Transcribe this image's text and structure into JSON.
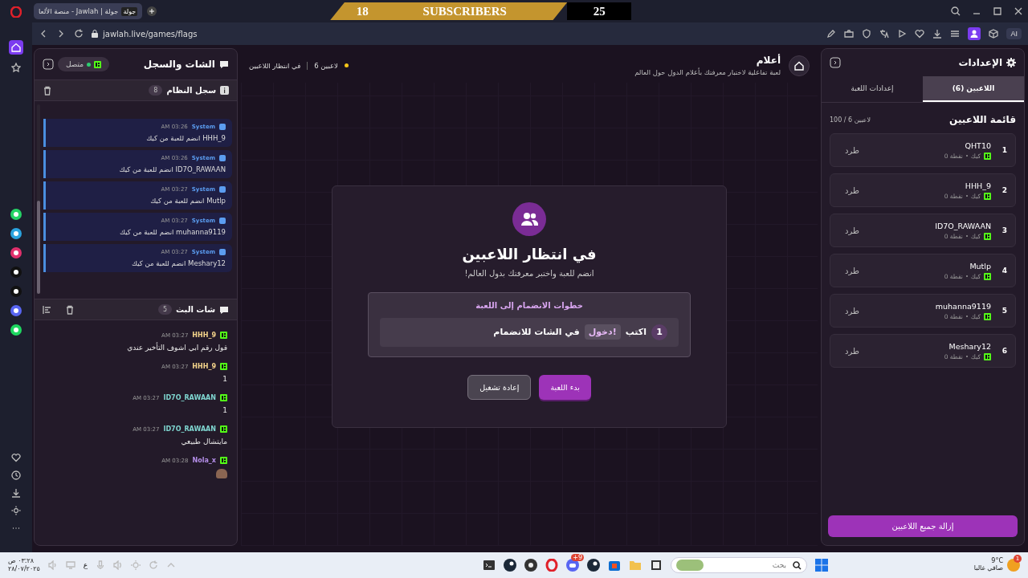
{
  "browser": {
    "tab_favicon": "جولة",
    "tab_title": "جولة | Jawlah - منصة الألعا",
    "url": "jawlah.live/games/flags",
    "ai_label": "AI"
  },
  "overlay": {
    "left_count": "18",
    "label": "SUBSCRIBERS",
    "right_count": "25"
  },
  "chat_panel": {
    "title": "الشات والسجل",
    "status": "متصل",
    "connected": true,
    "system_log": {
      "title": "سجل النظام",
      "count": "8",
      "messages": [
        {
          "sender": "System",
          "time": "03:26 AM",
          "text": "HHH_9 انضم للعبة من كيك"
        },
        {
          "sender": "System",
          "time": "03:26 AM",
          "text": "ID7O_RAWAAN انضم للعبة من كيك"
        },
        {
          "sender": "System",
          "time": "03:27 AM",
          "text": "Mutlp انضم للعبة من كيك"
        },
        {
          "sender": "System",
          "time": "03:27 AM",
          "text": "muhanna9119 انضم للعبة من كيك"
        },
        {
          "sender": "System",
          "time": "03:27 AM",
          "text": "Meshary12 انضم للعبة من كيك"
        }
      ]
    },
    "stream_chat": {
      "title": "شات البث",
      "count": "5",
      "messages": [
        {
          "user": "HHH_9",
          "color": "#f3d38a",
          "time": "03:27 AM",
          "kind": "text",
          "text": "قول رقم ابي اشوف التأخير عندي"
        },
        {
          "user": "HHH_9",
          "color": "#f3d38a",
          "time": "03:27 AM",
          "kind": "text",
          "text": "1"
        },
        {
          "user": "ID7O_RAWAAN",
          "color": "#7fd6d0",
          "time": "03:27 AM",
          "kind": "text",
          "text": "1"
        },
        {
          "user": "ID7O_RAWAAN",
          "color": "#7fd6d0",
          "time": "03:27 AM",
          "kind": "text",
          "text": "مايتشال طبيعي"
        },
        {
          "user": "Nola_x",
          "color": "#b48ee8",
          "time": "03:28 AM",
          "kind": "emote"
        }
      ]
    }
  },
  "game_header": {
    "title": "أعلام",
    "subtitle": "لعبة تفاعلية لاختبار معرفتك بأعلام الدول حول العالم",
    "players": "6 لاعبين",
    "status": "في انتظار اللاعبين"
  },
  "waiting_card": {
    "title": "في انتظار اللاعبين",
    "subtitle": "انضم للعبة واختبر معرفتك بدول العالم!",
    "steps_title": "خطوات الانضمام إلى اللعبة",
    "steps": [
      {
        "number": "1",
        "before": "اكتب",
        "keyword": "!دخول",
        "after": "في الشات للانضمام"
      }
    ],
    "buttons": [
      {
        "label": "بدء اللعبة",
        "kind": "primary"
      },
      {
        "label": "إعادة تشغيل",
        "kind": "secondary"
      }
    ]
  },
  "settings_panel": {
    "title": "الإعدادات",
    "tabs": [
      {
        "label": "اللاعبين (6)",
        "selected": true
      },
      {
        "label": "إعدادات اللعبة",
        "selected": false
      }
    ],
    "list_title": "قائمة اللاعبين",
    "capacity": "100 / 6 لاعبين",
    "players": [
      {
        "rank": "1",
        "name": "QHT10",
        "platform": "كيك",
        "points": "0 نقطة",
        "kick_label": "طرد"
      },
      {
        "rank": "2",
        "name": "HHH_9",
        "platform": "كيك",
        "points": "0 نقطة",
        "kick_label": "طرد"
      },
      {
        "rank": "3",
        "name": "ID7O_RAWAAN",
        "platform": "كيك",
        "points": "0 نقطة",
        "kick_label": "طرد"
      },
      {
        "rank": "4",
        "name": "Mutlp",
        "platform": "كيك",
        "points": "0 نقطة",
        "kick_label": "طرد"
      },
      {
        "rank": "5",
        "name": "muhanna9119",
        "platform": "كيك",
        "points": "0 نقطة",
        "kick_label": "طرد"
      },
      {
        "rank": "6",
        "name": "Meshary12",
        "platform": "كيك",
        "points": "0 نقطة",
        "kick_label": "طرد"
      }
    ],
    "clear_button": "إزالة جميع اللاعبين"
  },
  "taskbar": {
    "weather_temp": "9°C",
    "weather_text": "صافي غالبا",
    "weather_badge": "1",
    "search_placeholder": "بحث",
    "discord_badge": "9+",
    "language": "ع",
    "time": "٠٣:٢٨ ص",
    "date": "٢٨/٠٧/٢٠٢٥"
  }
}
